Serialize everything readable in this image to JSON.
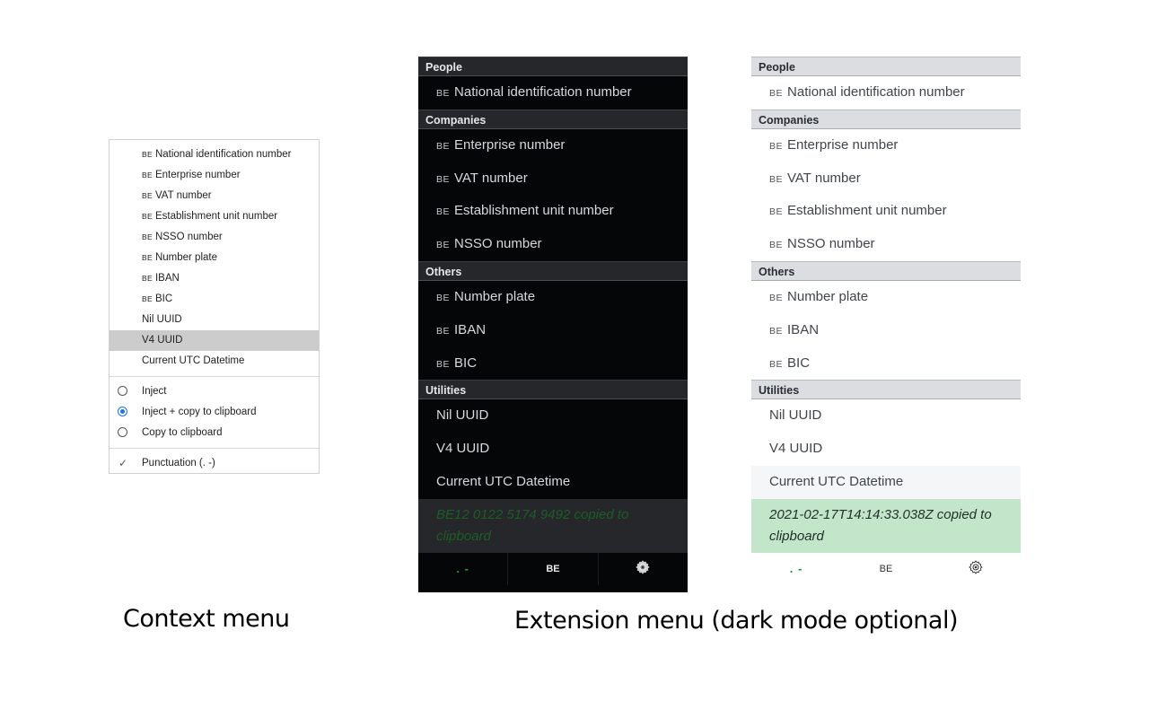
{
  "context_menu": {
    "items": [
      {
        "prefix": "BE",
        "label": "National identification number"
      },
      {
        "prefix": "BE",
        "label": "Enterprise number"
      },
      {
        "prefix": "BE",
        "label": "VAT number"
      },
      {
        "prefix": "BE",
        "label": "Establishment unit number"
      },
      {
        "prefix": "BE",
        "label": "NSSO number"
      },
      {
        "prefix": "BE",
        "label": "Number plate"
      },
      {
        "prefix": "BE",
        "label": "IBAN"
      },
      {
        "prefix": "BE",
        "label": "BIC"
      },
      {
        "prefix": "",
        "label": "Nil UUID"
      },
      {
        "prefix": "",
        "label": "V4 UUID",
        "highlighted": true
      },
      {
        "prefix": "",
        "label": "Current UTC Datetime"
      }
    ],
    "modes": [
      {
        "label": "Inject",
        "selected": false
      },
      {
        "label": "Inject + copy to clipboard",
        "selected": true
      },
      {
        "label": "Copy to clipboard",
        "selected": false
      }
    ],
    "punctuation": {
      "label": "Punctuation (. -)",
      "checked": true
    }
  },
  "extension_menu": {
    "sections": [
      {
        "title": "People",
        "items": [
          {
            "prefix": "BE",
            "label": "National identification number"
          }
        ]
      },
      {
        "title": "Companies",
        "items": [
          {
            "prefix": "BE",
            "label": "Enterprise number"
          },
          {
            "prefix": "BE",
            "label": "VAT number"
          },
          {
            "prefix": "BE",
            "label": "Establishment unit number"
          },
          {
            "prefix": "BE",
            "label": "NSSO number"
          }
        ]
      },
      {
        "title": "Others",
        "items": [
          {
            "prefix": "BE",
            "label": "Number plate"
          },
          {
            "prefix": "BE",
            "label": "IBAN"
          },
          {
            "prefix": "BE",
            "label": "BIC"
          }
        ]
      },
      {
        "title": "Utilities",
        "items": [
          {
            "prefix": "",
            "label": "Nil UUID"
          },
          {
            "prefix": "",
            "label": "V4 UUID"
          },
          {
            "prefix": "",
            "label": "Current UTC Datetime"
          }
        ]
      }
    ],
    "dark_toast": "BE12 0122 5174 9492 copied to clipboard",
    "light_toast": "2021-02-17T14:14:33.038Z copied to clipboard",
    "footer": {
      "punctuation_icon": ". -",
      "country": "BE",
      "settings_icon": "gear-icon"
    }
  },
  "captions": {
    "context": "Context menu",
    "extension": "Extension menu (dark mode optional)"
  },
  "colors": {
    "radio_accent": "#1a73e8",
    "toast_success_bg": "#c3e6cb",
    "punctuation_green": "#22a036"
  }
}
